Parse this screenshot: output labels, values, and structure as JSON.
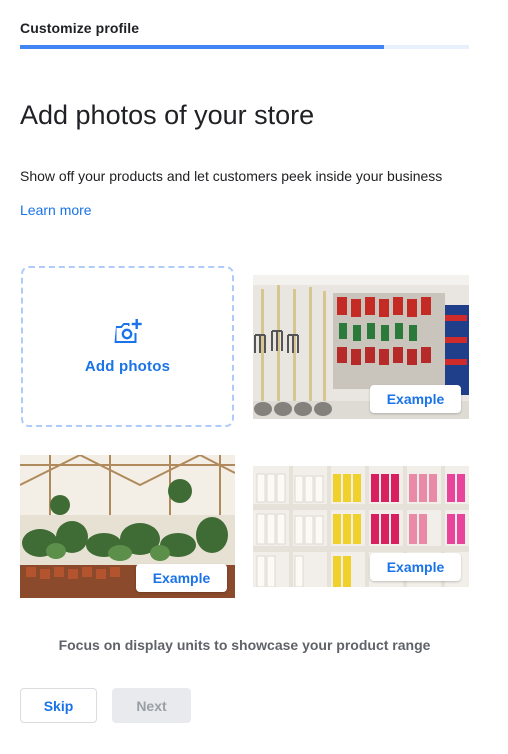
{
  "header": {
    "title": "Customize profile",
    "progress": 0.81
  },
  "main": {
    "title": "Add photos of your store",
    "subtitle": "Show off your products and let customers peek inside your business",
    "learn_more": "Learn more",
    "add_photos": {
      "label": "Add photos",
      "icon": "add-photo-camera-icon"
    },
    "examples": [
      {
        "badge": "Example",
        "scene": "hardware store tool wall"
      },
      {
        "badge": "Example",
        "scene": "garden center greenhouse"
      },
      {
        "badge": "Example",
        "scene": "candle display shelves"
      }
    ],
    "caption": "Focus on display units to showcase your product range"
  },
  "footer": {
    "skip_label": "Skip",
    "next_label": "Next"
  },
  "colors": {
    "accent": "#1a73e8",
    "progress": "#4285f4",
    "progress_track": "#e8f0fe",
    "dashed_border": "#aecbfa"
  }
}
